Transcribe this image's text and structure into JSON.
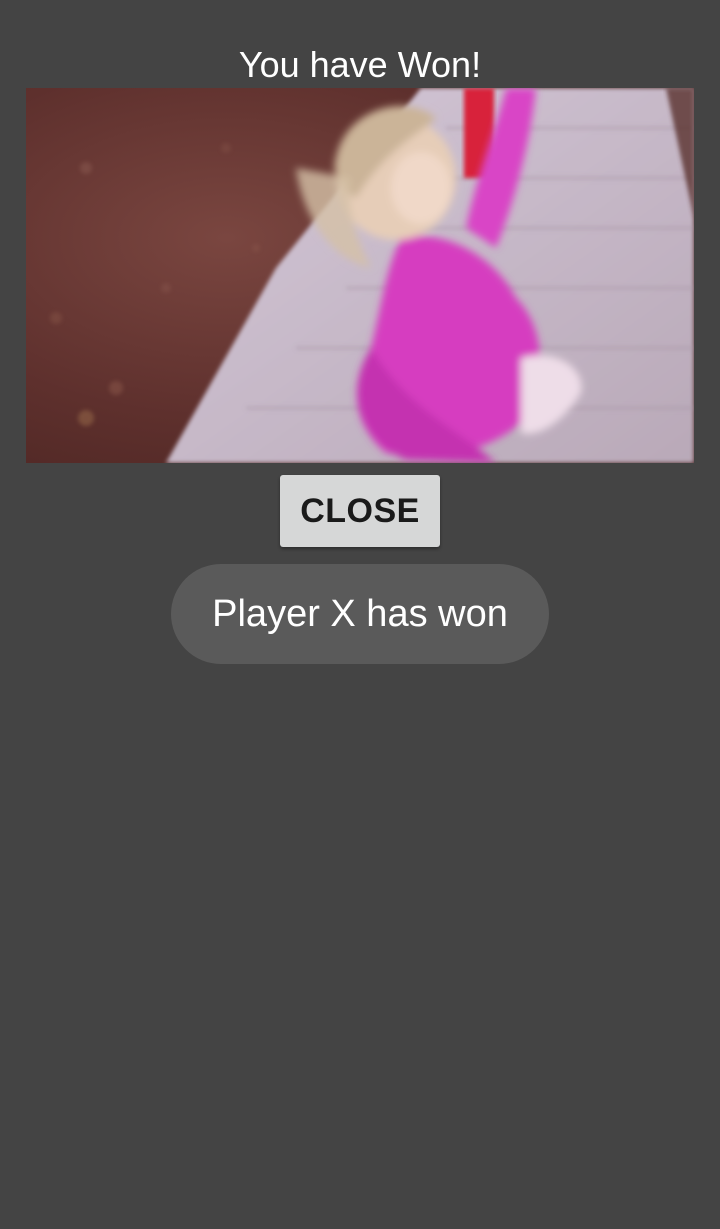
{
  "dialog": {
    "title": "You have Won!",
    "image_description": "",
    "close_label": "CLOSE"
  },
  "toast": {
    "message": "Player X has won"
  },
  "colors": {
    "background": "#444444",
    "button": "#d6d7d7",
    "toast": "#5a5a5a",
    "dress": "#d838c0"
  }
}
